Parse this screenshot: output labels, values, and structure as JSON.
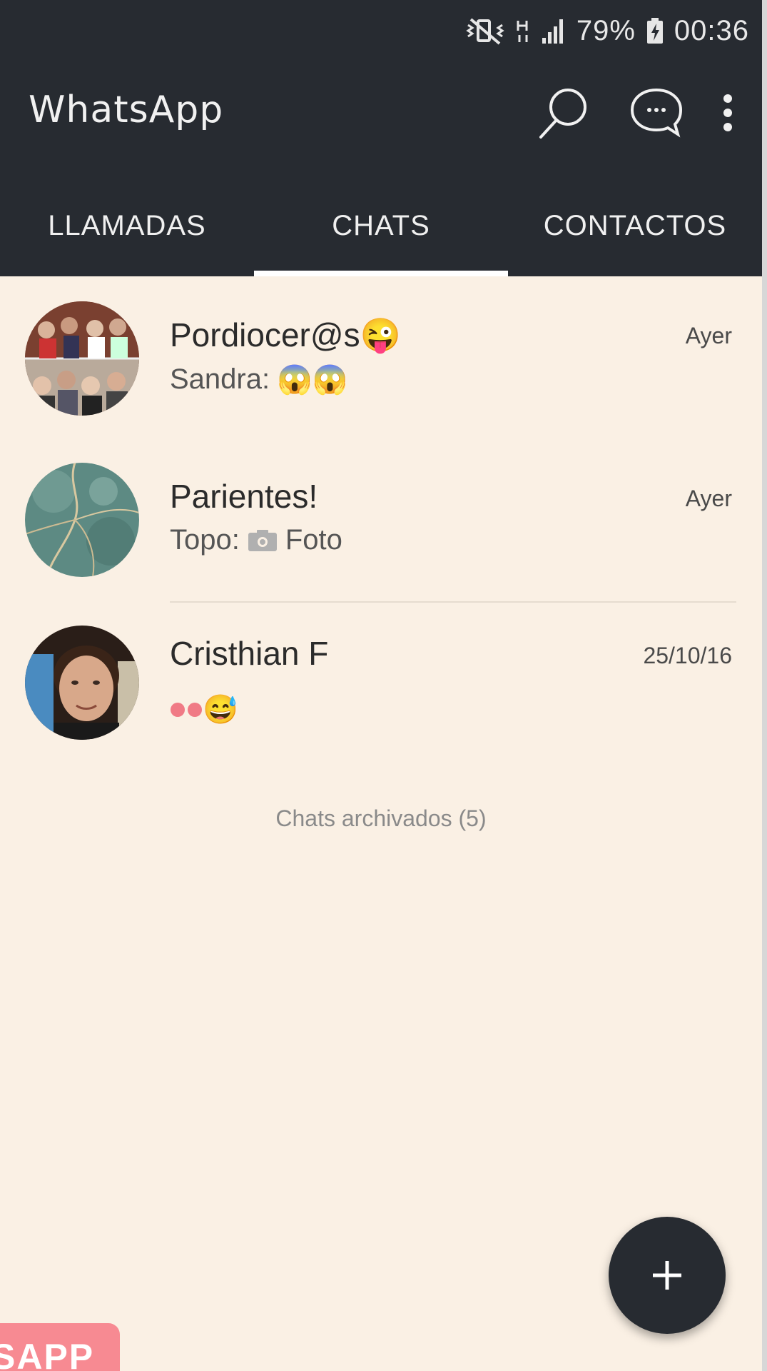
{
  "status_bar": {
    "battery_percent": "79%",
    "time": "00:36",
    "icons": [
      "vibrate-mute-icon",
      "hplus-data-icon",
      "signal-icon",
      "battery-charging-icon"
    ]
  },
  "app_bar": {
    "title": "WhatsApp",
    "actions": [
      "search-icon",
      "new-chat-icon",
      "overflow-menu-icon"
    ]
  },
  "tabs": [
    {
      "label": "LLAMADAS",
      "selected": false
    },
    {
      "label": "CHATS",
      "selected": true
    },
    {
      "label": "CONTACTOS",
      "selected": false
    }
  ],
  "chats": [
    {
      "name": "Pordiocer@s",
      "name_emoji": "😜",
      "time": "Ayer",
      "preview_sender": "Sandra:",
      "preview_text": "😱😱"
    },
    {
      "name": "Parientes!",
      "time": "Ayer",
      "preview_sender": "Topo:",
      "preview_text": "Foto",
      "preview_icon": "camera-icon"
    },
    {
      "name": "Cristhian F",
      "time": "25/10/16",
      "preview_text": "😅"
    }
  ],
  "archived": {
    "label": "Chats archivados (5)"
  },
  "fab": {
    "icon": "plus-icon"
  },
  "watermark": {
    "text": "SAPP"
  },
  "colors": {
    "header": "#272b31",
    "background": "#faf0e4",
    "tab_indicator": "#ffffff",
    "fab": "#272b31",
    "watermark": "#f78a92"
  }
}
